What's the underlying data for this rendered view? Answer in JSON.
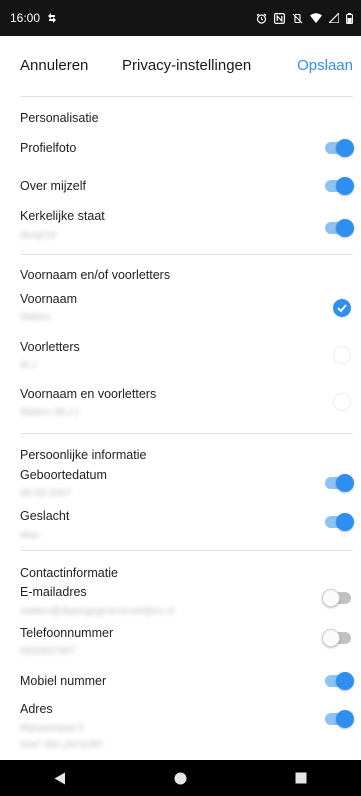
{
  "status_bar": {
    "time": "16:00",
    "icons": [
      "network-speed-icon",
      "alarm-icon",
      "nfc-icon",
      "vibrate-off-icon",
      "wifi-icon",
      "signal-icon",
      "battery-icon"
    ]
  },
  "header": {
    "cancel_label": "Annuleren",
    "title": "Privacy-instellingen",
    "save_label": "Opslaan"
  },
  "colors": {
    "accent": "#2f8ff0",
    "toggle_track_on": "#8dc2f4",
    "toggle_track_off": "#c2c2c2"
  },
  "sections": {
    "personalisatie": {
      "title": "Personalisatie",
      "profielfoto": {
        "label": "Profielfoto",
        "enabled": true
      },
      "over_mijzelf": {
        "label": "Over mijzelf",
        "enabled": true
      },
      "kerkelijke_staat": {
        "label": "Kerkelijke staat",
        "value": "doopl1d",
        "enabled": true
      }
    },
    "voornaam": {
      "title": "Voornaam en/of voorletters",
      "voornaam": {
        "label": "Voornaam",
        "value": "Matteo",
        "selected": true
      },
      "voorletters": {
        "label": "Voorletters",
        "value": "M.J.",
        "selected": false
      },
      "beide": {
        "label": "Voornaam en voorletters",
        "value": "Matteo (M.J.)",
        "selected": false
      }
    },
    "persoonlijk": {
      "title": "Persoonlijke informatie",
      "geboortedatum": {
        "label": "Geboortedatum",
        "value": "08-06-2007",
        "enabled": true
      },
      "geslacht": {
        "label": "Geslacht",
        "value": "Man",
        "enabled": true
      }
    },
    "contact": {
      "title": "Contactinformatie",
      "email": {
        "label": "E-mailadres",
        "value": "matteo@dejongegroenevelt@es.nl",
        "enabled": false
      },
      "telefoon": {
        "label": "Telefoonnummer",
        "value": "0602637907",
        "enabled": false
      },
      "mobiel": {
        "label": "Mobiel nummer",
        "enabled": true
      },
      "adres": {
        "label": "Adres",
        "line1": "Rijsweerpad 5",
        "line2": "5047 BN UNTERP",
        "enabled": true
      }
    }
  },
  "nav_bar": {
    "buttons": [
      "back-triangle-icon",
      "home-circle-icon",
      "recents-square-icon"
    ]
  }
}
